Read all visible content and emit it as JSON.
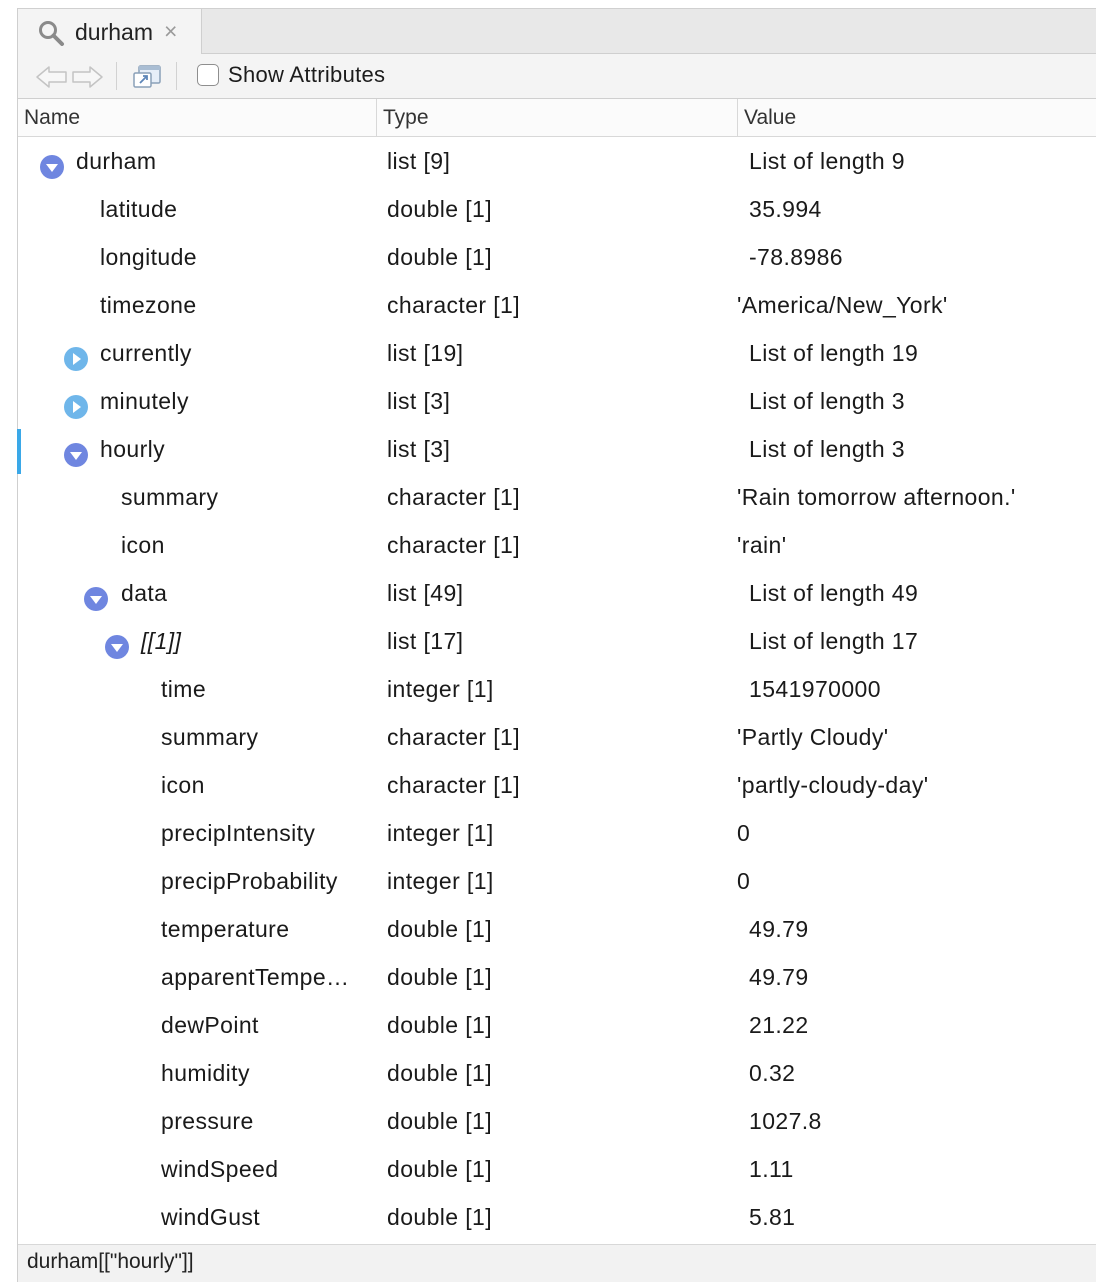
{
  "tab": {
    "label": "durham",
    "close_glyph": "×",
    "icon": "search-icon"
  },
  "toolbar": {
    "show_attributes_label": "Show Attributes",
    "show_attributes_checked": false
  },
  "columns": {
    "name": "Name",
    "type": "Type",
    "value": "Value"
  },
  "rows": [
    {
      "name": "durham",
      "type": "list [9]",
      "value": "List of length 9",
      "toggle": "expanded"
    },
    {
      "name": "latitude",
      "type": "double [1]",
      "value": "35.994"
    },
    {
      "name": "longitude",
      "type": "double [1]",
      "value": "-78.8986"
    },
    {
      "name": "timezone",
      "type": "character [1]",
      "value": "'America/New_York'"
    },
    {
      "name": "currently",
      "type": "list [19]",
      "value": "List of length 19",
      "toggle": "collapsed"
    },
    {
      "name": "minutely",
      "type": "list [3]",
      "value": "List of length 3",
      "toggle": "collapsed"
    },
    {
      "name": "hourly",
      "type": "list [3]",
      "value": "List of length 3",
      "toggle": "expanded",
      "selected": true
    },
    {
      "name": "summary",
      "type": "character [1]",
      "value": "'Rain tomorrow afternoon.'"
    },
    {
      "name": "icon",
      "type": "character [1]",
      "value": "'rain'"
    },
    {
      "name": "data",
      "type": "list [49]",
      "value": "List of length 49",
      "toggle": "expanded"
    },
    {
      "name": "[[1]]",
      "type": "list [17]",
      "value": "List of length 17",
      "toggle": "expanded"
    },
    {
      "name": "time",
      "type": "integer [1]",
      "value": "1541970000"
    },
    {
      "name": "summary",
      "type": "character [1]",
      "value": "'Partly Cloudy'"
    },
    {
      "name": "icon",
      "type": "character [1]",
      "value": "'partly-cloudy-day'"
    },
    {
      "name": "precipIntensity",
      "type": "integer [1]",
      "value": "0"
    },
    {
      "name": "precipProbability",
      "type": "integer [1]",
      "value": "0"
    },
    {
      "name": "temperature",
      "type": "double [1]",
      "value": "49.79"
    },
    {
      "name": "apparentTempe…",
      "type": "double [1]",
      "value": "49.79"
    },
    {
      "name": "dewPoint",
      "type": "double [1]",
      "value": "21.22"
    },
    {
      "name": "humidity",
      "type": "double [1]",
      "value": "0.32"
    },
    {
      "name": "pressure",
      "type": "double [1]",
      "value": "1027.8"
    },
    {
      "name": "windSpeed",
      "type": "double [1]",
      "value": "1.11"
    },
    {
      "name": "windGust",
      "type": "double [1]",
      "value": "5.81"
    }
  ],
  "status": {
    "path": "durham[[\"hourly\"]]"
  },
  "colors": {
    "toggle_expanded": "#6f86e0",
    "toggle_collapsed": "#6fb6ea",
    "selection": "#3aa8e8"
  }
}
